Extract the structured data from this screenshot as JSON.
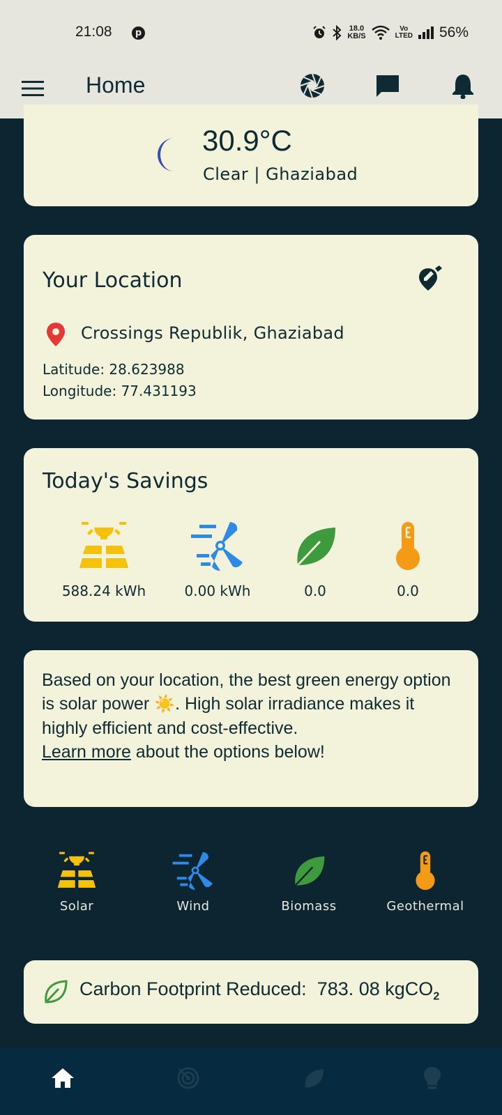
{
  "status_bar": {
    "time": "21:08",
    "speed_top": "18.0",
    "speed_unit": "KB/S",
    "volte_top": "Vo",
    "volte_bottom": "LTED",
    "battery": "56%"
  },
  "app_bar": {
    "title": "Home"
  },
  "weather": {
    "temperature": "30.9°C",
    "description": "Clear | Ghaziabad"
  },
  "location": {
    "heading": "Your Location",
    "place": "Crossings Republik, Ghaziabad",
    "latitude": "Latitude: 28.623988",
    "longitude": "Longitude: 77.431193"
  },
  "savings": {
    "heading": "Today's Savings",
    "solar": "588.24 kWh",
    "wind": "0.00 kWh",
    "biomass": "0.0",
    "geothermal": "0.0"
  },
  "advice": {
    "line1": "Based on your location,  the best green energy option is solar power ",
    "sun": "☀️",
    "line2": ".   High solar irradiance makes it highly efficient and cost-effective.",
    "link": "Learn more",
    "line3": " about the options below!"
  },
  "options": {
    "solar": "Solar",
    "wind": "Wind",
    "biomass": "Biomass",
    "geothermal": "Geothermal"
  },
  "carbon": {
    "label": "Carbon Footprint Reduced:",
    "value": "783. 08 kgCO",
    "sub": "2"
  },
  "colors": {
    "background": "#0c2530",
    "card": "#f3f3dc",
    "solar": "#f6c10b",
    "wind": "#2d8ae6",
    "leaf": "#3d9a3d",
    "geothermal": "#f59a14",
    "pin": "#e53935"
  }
}
